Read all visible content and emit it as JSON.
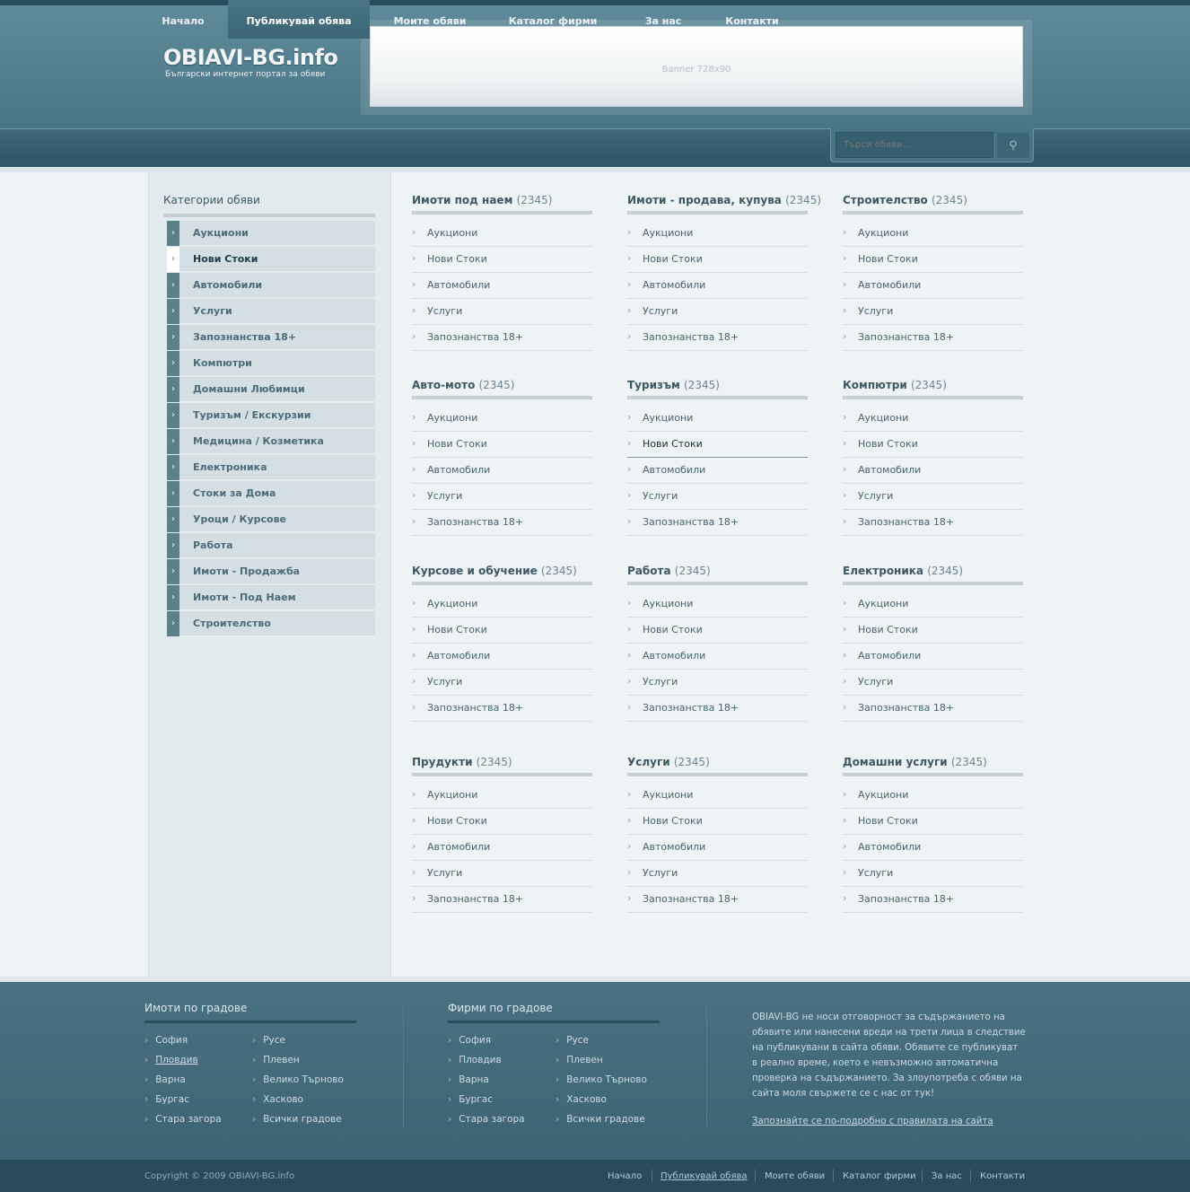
{
  "header": {
    "logo_title": "OBIAVI-BG.info",
    "logo_subtitle": "Български интернет портал за обяви",
    "banner_text": "Banner 728x90"
  },
  "nav": {
    "items": [
      {
        "label": "Начало"
      },
      {
        "label": "Публикувай обява",
        "active": true
      },
      {
        "label": "Моите обяви"
      },
      {
        "label": "Каталог фирми"
      },
      {
        "label": "За нас"
      },
      {
        "label": "Контакти"
      }
    ],
    "search_placeholder": "Търси обяви..."
  },
  "sidebar": {
    "title": "Категории обяви",
    "items": [
      {
        "label": "Аукциони"
      },
      {
        "label": "Нови Стоки",
        "active": true
      },
      {
        "label": "Автомобили"
      },
      {
        "label": "Услуги"
      },
      {
        "label": "Запознанства 18+"
      },
      {
        "label": "Компютри"
      },
      {
        "label": "Домашни Любимци"
      },
      {
        "label": "Туризъм / Екскурзии"
      },
      {
        "label": "Медицина / Козметика"
      },
      {
        "label": "Електроника"
      },
      {
        "label": "Стоки за Дома"
      },
      {
        "label": "Уроци / Курсове"
      },
      {
        "label": "Работа"
      },
      {
        "label": "Имоти - Продажба"
      },
      {
        "label": "Имоти - Под Наем"
      },
      {
        "label": "Строителство"
      }
    ]
  },
  "blocks": [
    {
      "title": "Имоти под наем",
      "count": "(2345)",
      "items": [
        "Аукциони",
        "Нови Стоки",
        "Автомобили",
        "Услуги",
        "Запознанства 18+"
      ]
    },
    {
      "title": "Имоти - продава, купува",
      "count": "(2345)",
      "items": [
        "Аукциони",
        "Нови Стоки",
        "Автомобили",
        "Услуги",
        "Запознанства 18+"
      ]
    },
    {
      "title": "Строителство",
      "count": "(2345)",
      "items": [
        "Аукциони",
        "Нови Стоки",
        "Автомобили",
        "Услуги",
        "Запознанства 18+"
      ]
    },
    {
      "title": "Авто-мото",
      "count": "(2345)",
      "items": [
        "Аукциони",
        "Нови Стоки",
        "Автомобили",
        "Услуги",
        "Запознанства 18+"
      ]
    },
    {
      "title": "Туризъм",
      "count": "(2345)",
      "items": [
        "Аукциони",
        "Нови Стоки",
        "Автомобили",
        "Услуги",
        "Запознанства 18+"
      ]
    },
    {
      "title": "Компютри",
      "count": "(2345)",
      "items": [
        "Аукциони",
        "Нови Стоки",
        "Автомобили",
        "Услуги",
        "Запознанства 18+"
      ]
    },
    {
      "title": "Курсове и обучение",
      "count": "(2345)",
      "items": [
        "Аукциони",
        "Нови Стоки",
        "Автомобили",
        "Услуги",
        "Запознанства 18+"
      ]
    },
    {
      "title": "Работа",
      "count": "(2345)",
      "items": [
        "Аукциони",
        "Нови Стоки",
        "Автомобили",
        "Услуги",
        "Запознанства 18+"
      ]
    },
    {
      "title": "Електроника",
      "count": "(2345)",
      "items": [
        "Аукциони",
        "Нови Стоки",
        "Автомобили",
        "Услуги",
        "Запознанства 18+"
      ]
    },
    {
      "title": "Прудукти",
      "count": "(2345)",
      "items": [
        "Аукциони",
        "Нови Стоки",
        "Автомобили",
        "Услуги",
        "Запознанства 18+"
      ]
    },
    {
      "title": "Услуги",
      "count": "(2345)",
      "items": [
        "Аукциони",
        "Нови Стоки",
        "Автомобили",
        "Услуги",
        "Запознанства 18+"
      ]
    },
    {
      "title": "Домашни услуги",
      "count": "(2345)",
      "items": [
        "Аукциони",
        "Нови Стоки",
        "Автомобили",
        "Услуги",
        "Запознанства 18+"
      ]
    }
  ],
  "footer": {
    "realestate": {
      "title": "Имоти по градове",
      "col1": [
        "София",
        "Пловдив",
        "Варна",
        "Бургас",
        "Стара загора"
      ],
      "col2": [
        "Русе",
        "Плевен",
        "Велико Търново",
        "Хасково",
        "Всички градове"
      ]
    },
    "firms": {
      "title": "Фирми по градове",
      "col1": [
        "София",
        "Пловдив",
        "Варна",
        "Бургас",
        "Стара загора"
      ],
      "col2": [
        "Русе",
        "Плевен",
        "Велико Търново",
        "Хасково",
        "Всички градове"
      ]
    },
    "disclaimer": "OBIAVI-BG не носи отговорност за съдържанието на обявите или нанесени вреди на трети лица в следствие на публикувани в сайта обяви. Обявите се публикуват в реално време, което е невъзможно автоматична проверка на съдържанието. За злоупотреба с обяви на сайта моля свържете се с нас от тук!",
    "rules_link": "Запознайте се по-подробно с правилата на сайта",
    "copyright": "Copyright © 2009 OBIAVI-BG.info",
    "nav": [
      "Начало",
      "Публикувай обява",
      "Моите обяви",
      "Каталог фирми",
      "За нас",
      "Контакти"
    ]
  },
  "colors": {
    "header": "#4a7585",
    "nav": "#2f5566",
    "sidebar_icon": "#5c7f8c",
    "footer": "#3c6473",
    "bottom_bar": "#284c5b"
  }
}
